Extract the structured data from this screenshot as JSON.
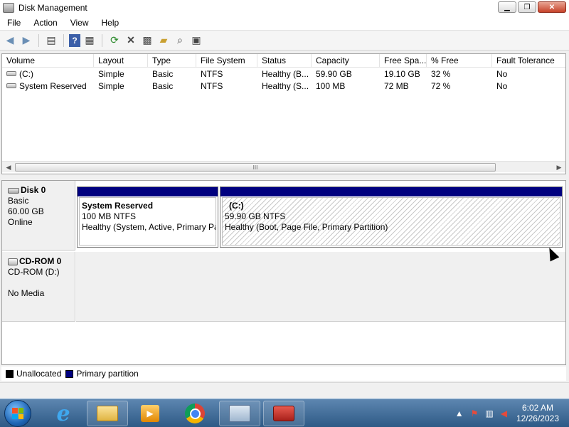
{
  "window": {
    "title": "Disk Management"
  },
  "menu": [
    "File",
    "Action",
    "View",
    "Help"
  ],
  "toolbar": {
    "buttons": [
      "back-icon",
      "forward-icon",
      "properties-icon",
      "help-icon",
      "view-icon",
      "refresh-icon",
      "delete-icon",
      "settings-icon",
      "folder-open-icon",
      "search-icon",
      "rescan-icon"
    ]
  },
  "volume_list": {
    "columns": [
      "Volume",
      "Layout",
      "Type",
      "File System",
      "Status",
      "Capacity",
      "Free Spa...",
      "% Free",
      "Fault Tolerance"
    ],
    "rows": [
      [
        "(C:)",
        "Simple",
        "Basic",
        "NTFS",
        "Healthy (B...",
        "59.90 GB",
        "19.10 GB",
        "32 %",
        "No"
      ],
      [
        "System Reserved",
        "Simple",
        "Basic",
        "NTFS",
        "Healthy (S...",
        "100 MB",
        "72 MB",
        "72 %",
        "No"
      ]
    ],
    "scroll_grip": "III"
  },
  "disks": [
    {
      "name": "Disk 0",
      "type": "Basic",
      "size": "60.00 GB",
      "state": "Online",
      "partitions": [
        {
          "name": "System Reserved",
          "size": "100 MB NTFS",
          "status": "Healthy (System, Active, Primary Pa"
        },
        {
          "name": "(C:)",
          "size": "59.90 GB NTFS",
          "status": "Healthy (Boot, Page File, Primary Partition)"
        }
      ]
    },
    {
      "name": "CD-ROM 0",
      "drive": "CD-ROM (D:)",
      "media": "No Media"
    }
  ],
  "legend": [
    {
      "label": "Unallocated",
      "color": "#000000"
    },
    {
      "label": "Primary partition",
      "color": "#00007f"
    }
  ],
  "taskbar": {
    "apps": [
      "internet-explorer",
      "windows-explorer",
      "media-player",
      "chrome",
      "computer-management",
      "toolbox"
    ],
    "clock": {
      "time": "6:02 AM",
      "date": "12/26/2023"
    }
  }
}
